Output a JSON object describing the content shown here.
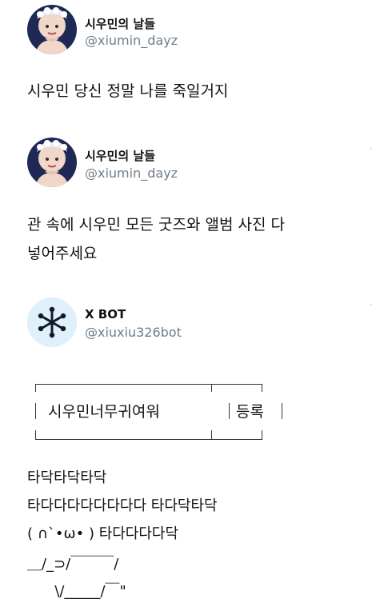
{
  "tweets": [
    {
      "name": "시우민의 날들",
      "handle": "@xiumin_dayz",
      "text": "시우민 당신 정말 나를 죽일거지"
    },
    {
      "name": "시우민의 날들",
      "handle": "@xiumin_dayz",
      "text": "관 속에 시우민 모든 굿즈와 앨범 사진 다\n넣어주세요"
    },
    {
      "name": "X BOT",
      "handle": "@xiuxiu326bot",
      "search": {
        "query": "시우민너무귀여워",
        "button": "등록"
      },
      "lines": [
        "타닥타닥타닥",
        "타다다다다다다다다 타다닥타닥",
        "( ∩`•ω• ) 타다다다다닥",
        "＿/_⊃/￣￣￣/",
        "      \\/_____/￣\""
      ]
    }
  ],
  "icons": {
    "avatar_person": "person-photo-avatar",
    "avatar_bot": "snowflake-bot-avatar"
  },
  "colors": {
    "handle": "#6f7d89",
    "text": "#111111",
    "bot_avatar_bg": "#dff0fb",
    "bot_glyph": "#0f1a2a"
  }
}
